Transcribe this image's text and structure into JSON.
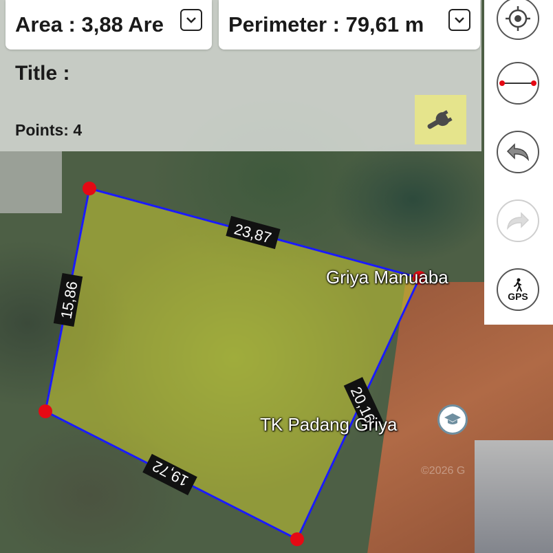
{
  "header": {
    "area_label": "Area : 3,88 Are",
    "perimeter_label": "Perimeter : 79,61 m",
    "title_label": "Title :",
    "points_label": "Points: 4"
  },
  "map": {
    "labels": {
      "place1": "Griya Manuaba",
      "place2": "TK Padang Griya",
      "watermark": "©2026 G"
    },
    "segments": [
      "23,87",
      "20,16",
      "19,72",
      "15,86"
    ]
  },
  "sidebar": {
    "buttons": [
      {
        "icon": "locate-icon"
      },
      {
        "icon": "measure-line-icon"
      },
      {
        "icon": "undo-icon"
      },
      {
        "icon": "redo-icon"
      },
      {
        "icon": "gps-icon",
        "label": "GPS"
      }
    ]
  },
  "colors": {
    "polygon_fill": "#c8c832",
    "polygon_stroke": "#1a1aff",
    "vertex": "#e50914",
    "tool_button_bg": "#e5e48c"
  }
}
